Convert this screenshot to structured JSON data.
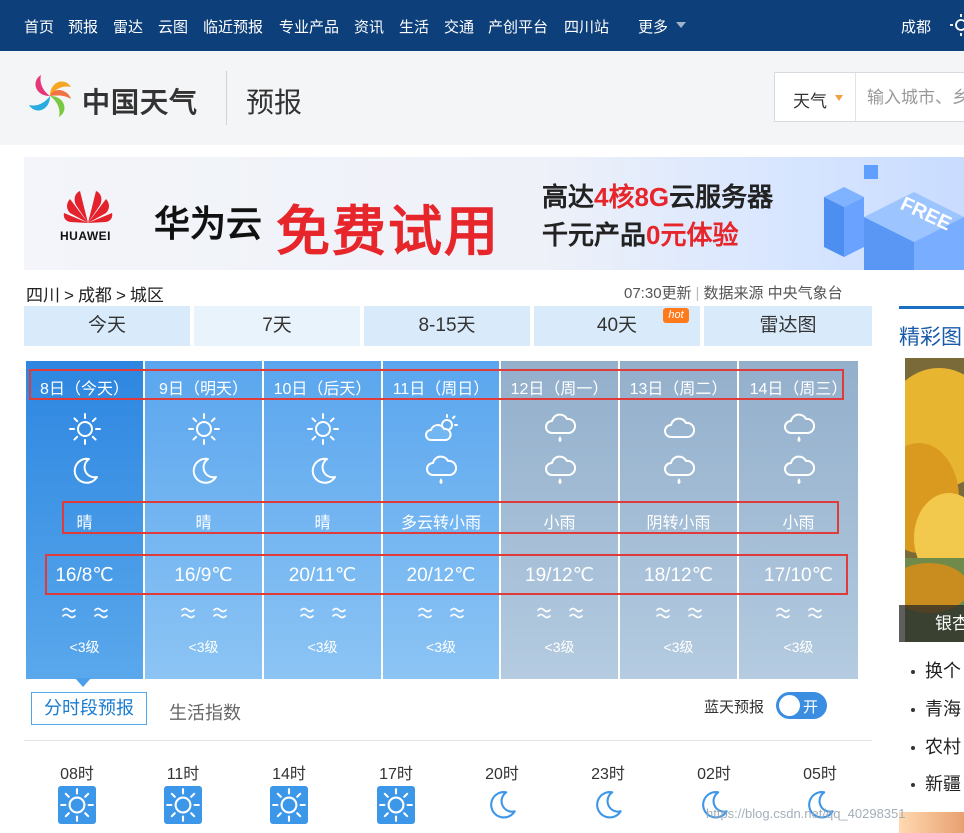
{
  "topnav": {
    "items": [
      "首页",
      "预报",
      "雷达",
      "云图",
      "临近预报",
      "专业产品",
      "资讯",
      "生活",
      "交通",
      "产创平台",
      "四川站",
      "更多"
    ],
    "city": "成都"
  },
  "header": {
    "logo_text": "中国天气",
    "title": "预报",
    "search_select": "天气",
    "search_placeholder": "输入城市、乡镇、街道、景点名称"
  },
  "banner": {
    "brand_en": "HUAWEI",
    "brand": "华为云",
    "headline": "免费试用",
    "line1_prefix": "高达",
    "line1_hl": "4核8G",
    "line1_suffix": "云服务器",
    "line2_prefix": "千元产品",
    "line2_hl": "0元体验",
    "graphic_text": "FREE"
  },
  "breadcrumb": [
    "四川",
    ">",
    "成都",
    ">",
    "城区"
  ],
  "update": {
    "time": "07:30更新",
    "source": "数据来源 中央气象台"
  },
  "tabs": [
    {
      "label": "今天"
    },
    {
      "label": "7天"
    },
    {
      "label": "8-15天"
    },
    {
      "label": "40天",
      "badge": "hot"
    },
    {
      "label": "雷达图"
    }
  ],
  "forecast": [
    {
      "date": "8日（今天）",
      "icon_day": "sun-icon",
      "icon_night": "moon-icon",
      "weather": "晴",
      "temp": "16/8℃",
      "wind": "<3级",
      "color": "#3b94e6"
    },
    {
      "date": "9日（明天）",
      "icon_day": "sun-icon",
      "icon_night": "moon-icon",
      "weather": "晴",
      "temp": "16/9℃",
      "wind": "<3级",
      "color": "#72b6f2"
    },
    {
      "date": "10日（后天）",
      "icon_day": "sun-icon",
      "icon_night": "moon-icon",
      "weather": "晴",
      "temp": "20/11℃",
      "wind": "<3级",
      "color": "#72b6f2"
    },
    {
      "date": "11日（周日）",
      "icon_day": "partly-cloudy-icon",
      "icon_night": "rain-icon",
      "weather": "多云转小雨",
      "temp": "20/12℃",
      "wind": "<3级",
      "color": "#72b6f2"
    },
    {
      "date": "12日（周一）",
      "icon_day": "rain-icon",
      "icon_night": "rain-icon",
      "weather": "小雨",
      "temp": "19/12℃",
      "wind": "<3级",
      "color": "#a7bfd6"
    },
    {
      "date": "13日（周二）",
      "icon_day": "cloud-icon",
      "icon_night": "rain-icon",
      "weather": "阴转小雨",
      "temp": "18/12℃",
      "wind": "<3级",
      "color": "#a7bfd6"
    },
    {
      "date": "14日（周三）",
      "icon_day": "rain-icon",
      "icon_night": "rain-icon",
      "weather": "小雨",
      "temp": "17/10℃",
      "wind": "<3级",
      "color": "#a7bfd6"
    }
  ],
  "subtabs": {
    "active": "分时段预报",
    "other": "生活指数",
    "bluesky_label": "蓝天预报",
    "toggle_label": "开"
  },
  "hourly": [
    {
      "time": "08时",
      "icon": "sun-icon"
    },
    {
      "time": "11时",
      "icon": "sun-icon"
    },
    {
      "time": "14时",
      "icon": "sun-icon"
    },
    {
      "time": "17时",
      "icon": "sun-icon"
    },
    {
      "time": "20时",
      "icon": "moon-icon"
    },
    {
      "time": "23时",
      "icon": "moon-icon"
    },
    {
      "time": "02时",
      "icon": "moon-icon"
    },
    {
      "time": "05时",
      "icon": "moon-icon"
    }
  ],
  "sidebar": {
    "title": "精彩图",
    "photo_caption": "银杏",
    "news": [
      "换个",
      "青海",
      "农村",
      "新疆"
    ]
  },
  "watermark": "https://blog.csdn.net/qq_40298351"
}
